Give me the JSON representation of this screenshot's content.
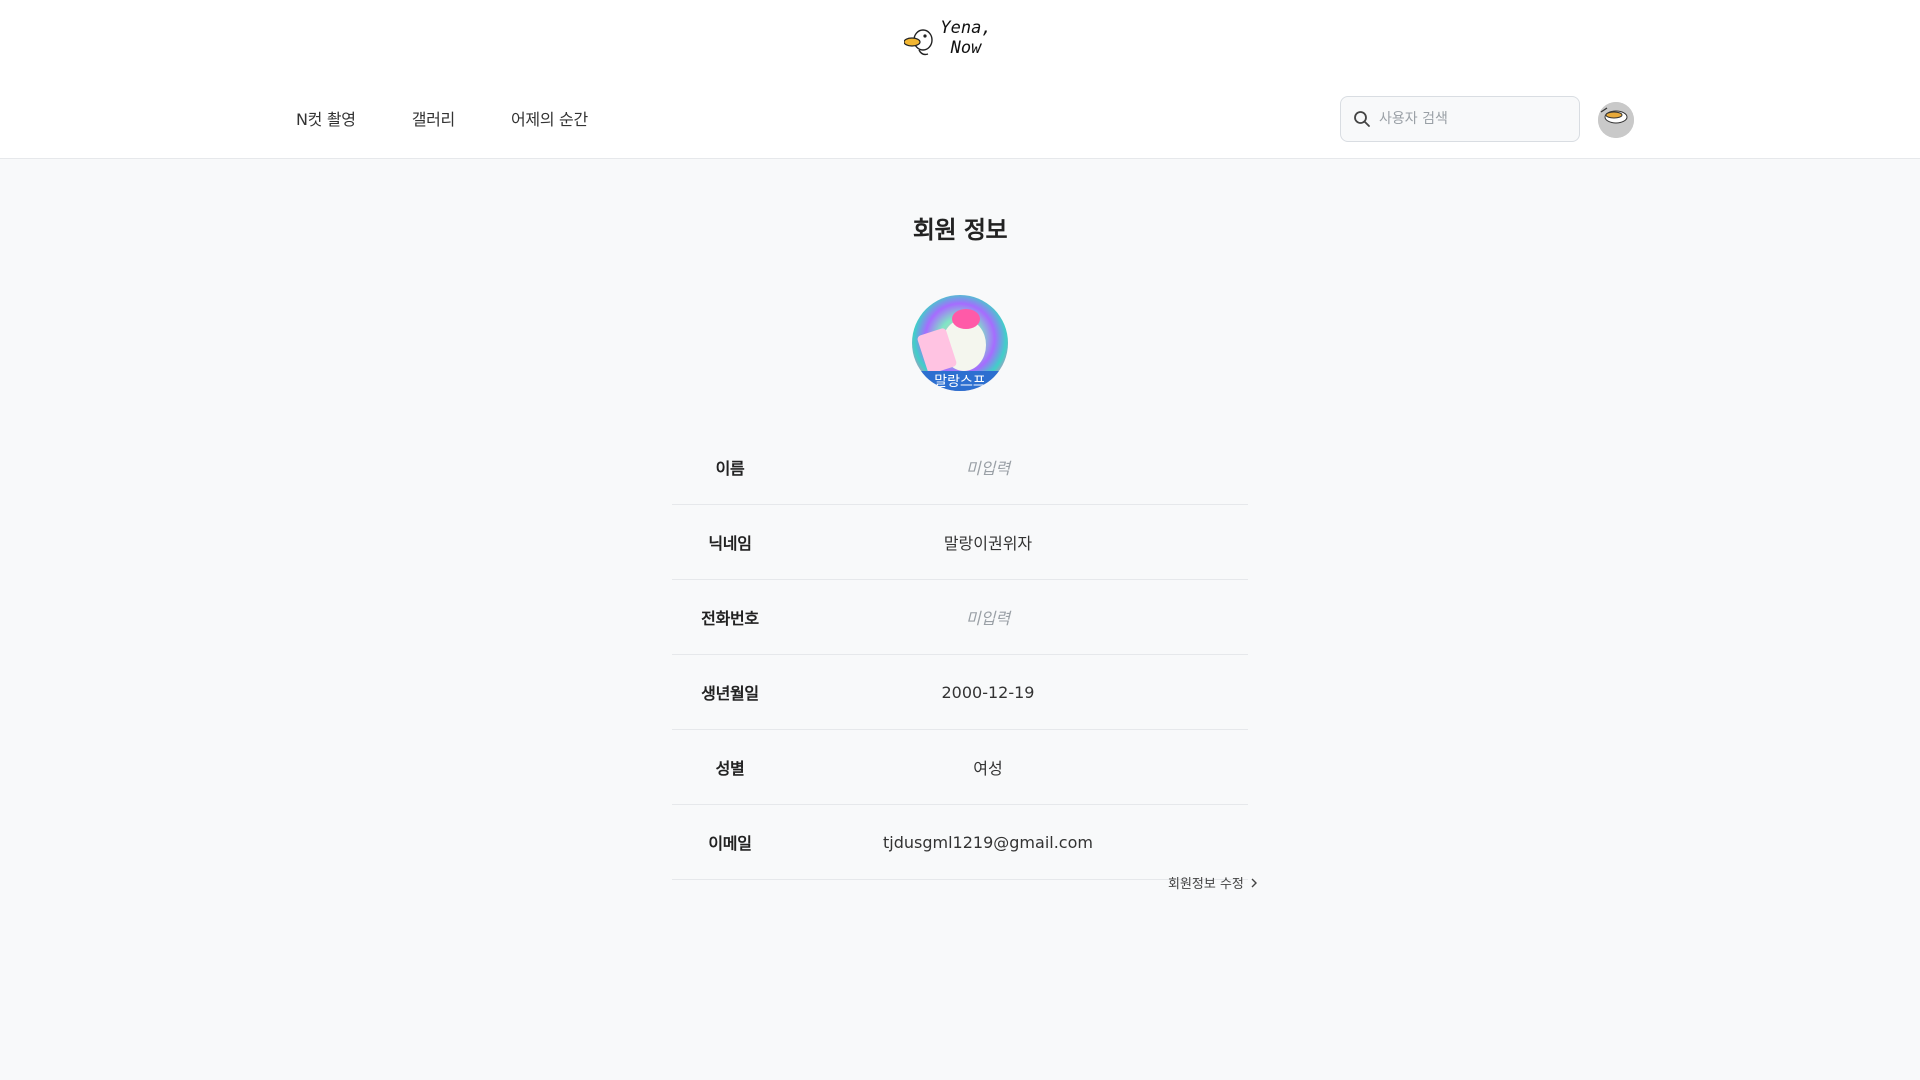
{
  "header": {
    "logo": {
      "line1": "Yena,",
      "line2": "Now"
    },
    "nav": [
      {
        "label": "N컷 촬영"
      },
      {
        "label": "갤러리"
      },
      {
        "label": "어제의 순간"
      }
    ],
    "search": {
      "placeholder": "사용자 검색",
      "value": ""
    }
  },
  "main": {
    "title": "회원 정보",
    "profile_badge_text": "말랑스프",
    "rows": [
      {
        "label": "이름",
        "value": "미입력",
        "empty": true
      },
      {
        "label": "닉네임",
        "value": "말랑이권위자",
        "empty": false
      },
      {
        "label": "전화번호",
        "value": "미입력",
        "empty": true
      },
      {
        "label": "생년월일",
        "value": "2000-12-19",
        "empty": false
      },
      {
        "label": "성별",
        "value": "여성",
        "empty": false
      },
      {
        "label": "이메일",
        "value": "tjdusgml1219@gmail.com",
        "empty": false
      }
    ],
    "edit_link": "회원정보 수정"
  },
  "icons": {
    "search": "search-icon",
    "chevron": "chevron-right-icon",
    "logo_duck": "duck-icon"
  },
  "colors": {
    "background": "#f8f9fa",
    "header_bg": "#ffffff",
    "placeholder": "#9aa0a6",
    "border": "#e6e8eb"
  }
}
